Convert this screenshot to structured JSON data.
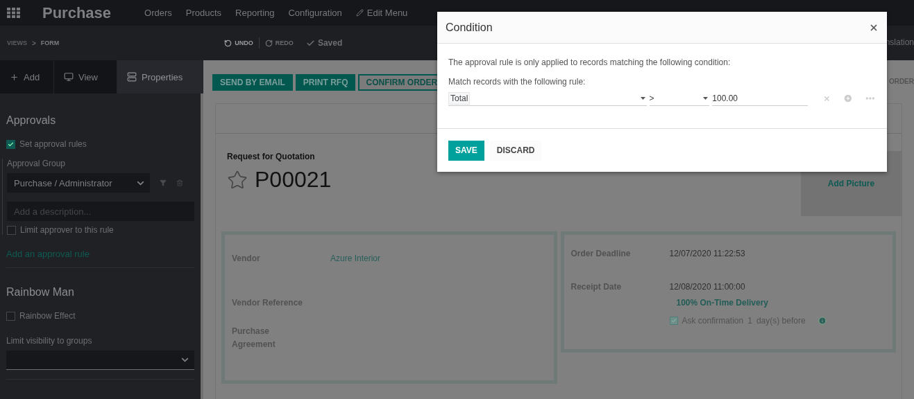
{
  "navbar": {
    "app_title": "Purchase",
    "menu": [
      "Orders",
      "Products",
      "Reporting",
      "Configuration"
    ],
    "edit_menu": "Edit Menu"
  },
  "studio_bar": {
    "breadcrumbs": [
      "VIEWS",
      "FORM"
    ],
    "separator": ">",
    "undo": {
      "label": "UNDO",
      "disabled": false
    },
    "redo": {
      "label": "REDO",
      "disabled": true
    },
    "status": "Saved",
    "right_text": "nslation"
  },
  "sidebar": {
    "tabs": [
      {
        "label": "Add",
        "selected": false
      },
      {
        "label": "View",
        "selected": false
      },
      {
        "label": "Properties",
        "selected": true
      }
    ],
    "approvals": {
      "title": "Approvals",
      "set_rules": {
        "label": "Set approval rules",
        "checked": true
      },
      "group_label": "Approval Group",
      "group_value": "Purchase / Administrator",
      "description_placeholder": "Add a description...",
      "limit_approver": {
        "label": "Limit approver to this rule",
        "checked": false
      },
      "add_rule": "Add an approval rule"
    },
    "rainbow": {
      "title": "Rainbow Man",
      "effect": {
        "label": "Rainbow Effect",
        "checked": false
      },
      "visibility_label": "Limit visibility to groups"
    }
  },
  "form": {
    "buttons": [
      {
        "label": "SEND BY EMAIL",
        "kind": "primary"
      },
      {
        "label": "PRINT RFQ",
        "kind": "primary"
      },
      {
        "label": "CONFIRM ORDER",
        "kind": "outline"
      }
    ],
    "right_button": "ORDER",
    "subtitle": "Request for Quotation",
    "name": "P00021",
    "add_picture": "Add Picture",
    "left_fields": [
      {
        "label": "Vendor",
        "value": "Azure Interior"
      },
      {
        "label": "Vendor Reference"
      },
      {
        "label": "Purchase Agreement"
      }
    ],
    "right_fields": [
      {
        "label": "Order Deadline",
        "value": "12/07/2020 11:22:53"
      },
      {
        "label": "Receipt Date",
        "value": "12/08/2020 11:00:00"
      }
    ],
    "on_time": "100% On-Time Delivery",
    "ask_confirmation": {
      "checked": true,
      "before": "Ask confirmation",
      "days": "1",
      "after": "day(s) before"
    }
  },
  "dialog": {
    "title": "Condition",
    "intro": "The approval rule is only applied to records matching the following condition:",
    "rule_label": "Match records with the following rule:",
    "rule": {
      "field": "Total",
      "operator": ">",
      "value": "100.00"
    },
    "buttons": [
      {
        "label": "SAVE",
        "kind": "primary"
      },
      {
        "label": "DISCARD",
        "kind": "secondary"
      }
    ]
  }
}
